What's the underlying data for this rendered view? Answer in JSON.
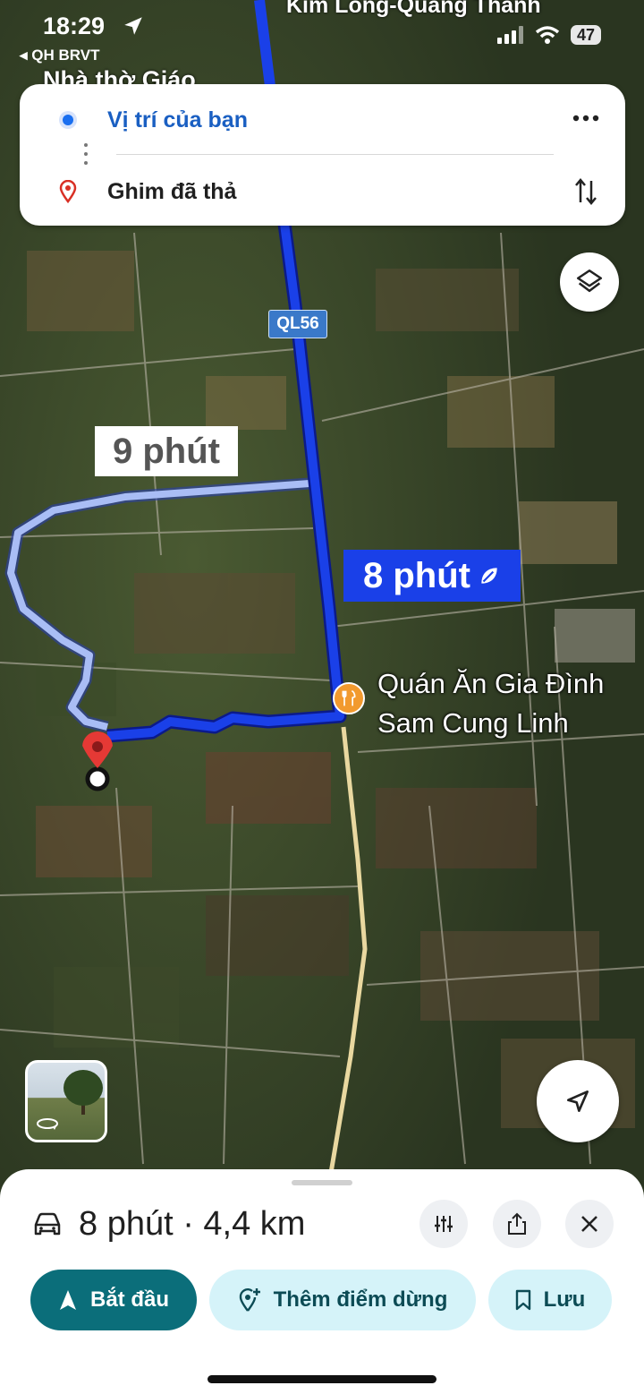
{
  "status_bar": {
    "time": "18:29",
    "back_app": "QH BRVT",
    "battery": "47"
  },
  "map_labels": {
    "top_road": "Kim Long-Quảng Thành",
    "place": "Nhà thờ Giáo",
    "road_shield": "QL56",
    "alt_route_time": "9 phút",
    "main_route_time": "8 phút",
    "poi_line1": "Quán Ăn Gia Đình",
    "poi_line2": "Sam Cung Linh"
  },
  "directions": {
    "origin": "Vị trí của bạn",
    "destination": "Ghim đã thả"
  },
  "sheet": {
    "summary": "8 phút · 4,4 km",
    "start_label": "Bắt đầu",
    "add_stop_label": "Thêm điểm dừng",
    "save_label": "Lưu"
  },
  "colors": {
    "main_route": "#1a40e8",
    "alt_route": "#a9bdf5",
    "start_button": "#0b6e7a",
    "secondary_button": "#d5f3f9",
    "pin": "#e53935"
  },
  "icons": [
    "location-arrow-icon",
    "wifi-icon",
    "signal-icon",
    "more-icon",
    "swap-icon",
    "layers-icon",
    "car-icon",
    "filter-icon",
    "share-icon",
    "close-icon",
    "navigate-icon",
    "add-stop-icon",
    "bookmark-icon",
    "locate-icon",
    "restaurant-icon",
    "pin-icon",
    "leaf-icon"
  ]
}
